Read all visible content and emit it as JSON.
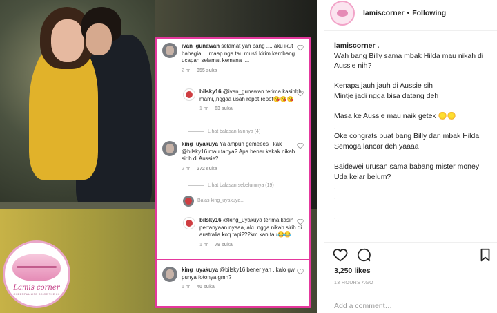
{
  "post": {
    "username": "lamiscorner",
    "separator": "•",
    "follow_status": "Following",
    "caption_user": "lamiscorner .",
    "caption_lines": [
      "Wah bang Billy sama mbak Hilda mau nikah di Aussie nih?",
      "",
      "Kenapa jauh jauh di Aussie sih",
      "Mintje jadi ngga bisa datang deh",
      "",
      "Masa ke Aussie mau naik getek 😑😑",
      ".",
      "Oke congrats buat bang Billy dan mbak Hilda",
      "Semoga lancar deh yaaaa",
      "",
      "Baidewei urusan sama babang mister money Uda kelar belum?",
      ".",
      ".",
      ".",
      ".",
      "."
    ],
    "likes": "3,250 likes",
    "time_ago": "13 HOURS AGO",
    "add_comment_placeholder": "Add a comment…"
  },
  "logo": {
    "name": "Lamis corner",
    "tagline": "CHEERFUL LIFE SINCE THE 2K"
  },
  "comments": {
    "c1": {
      "user": "ivan_gunawan",
      "text": "selamat yah bang .... aku ikut bahagia ... maap nga tau musti kirim kembang ucapan selamat kemana ....",
      "time": "2 hr",
      "likes": "355 suka"
    },
    "r1": {
      "user": "bilsky16",
      "text": "@ivan_gunawan terima kasihhh mami,,nggaa usah repot repot😘😘😘",
      "time": "1 hr",
      "likes": "83 suka"
    },
    "more1": "Lihat balasan lainnya (4)",
    "c2": {
      "user": "king_uyakuya",
      "text": "Ya ampun gemeees , kak @bilsky16 mau tanya? Apa bener kakak nikah sirih di Aussie?",
      "time": "2 hr",
      "likes": "272 suka"
    },
    "more2": "Lihat balasan sebelumnya (19)",
    "reply_to": "Balas king_uyakuya...",
    "r2": {
      "user": "bilsky16",
      "text": "@king_uyakuya terima kasih pertanyaan nyaaa,,aku ngga nikah sirih di australia koq.tapi???km kan tau😂😂",
      "time": "1 hr",
      "likes": "79 suka"
    },
    "c3": {
      "user": "king_uyakuya",
      "text": "@bilsky16 bener yah , kalo gw punya fotonya gmn?",
      "time": "1 hr",
      "likes": "40 suka"
    }
  },
  "icons": {
    "heart": "heart-icon",
    "comment": "comment-bubble-icon",
    "bookmark": "bookmark-icon"
  },
  "colors": {
    "highlight_border": "#e5389d",
    "logo_pink": "#e9a6c9"
  }
}
